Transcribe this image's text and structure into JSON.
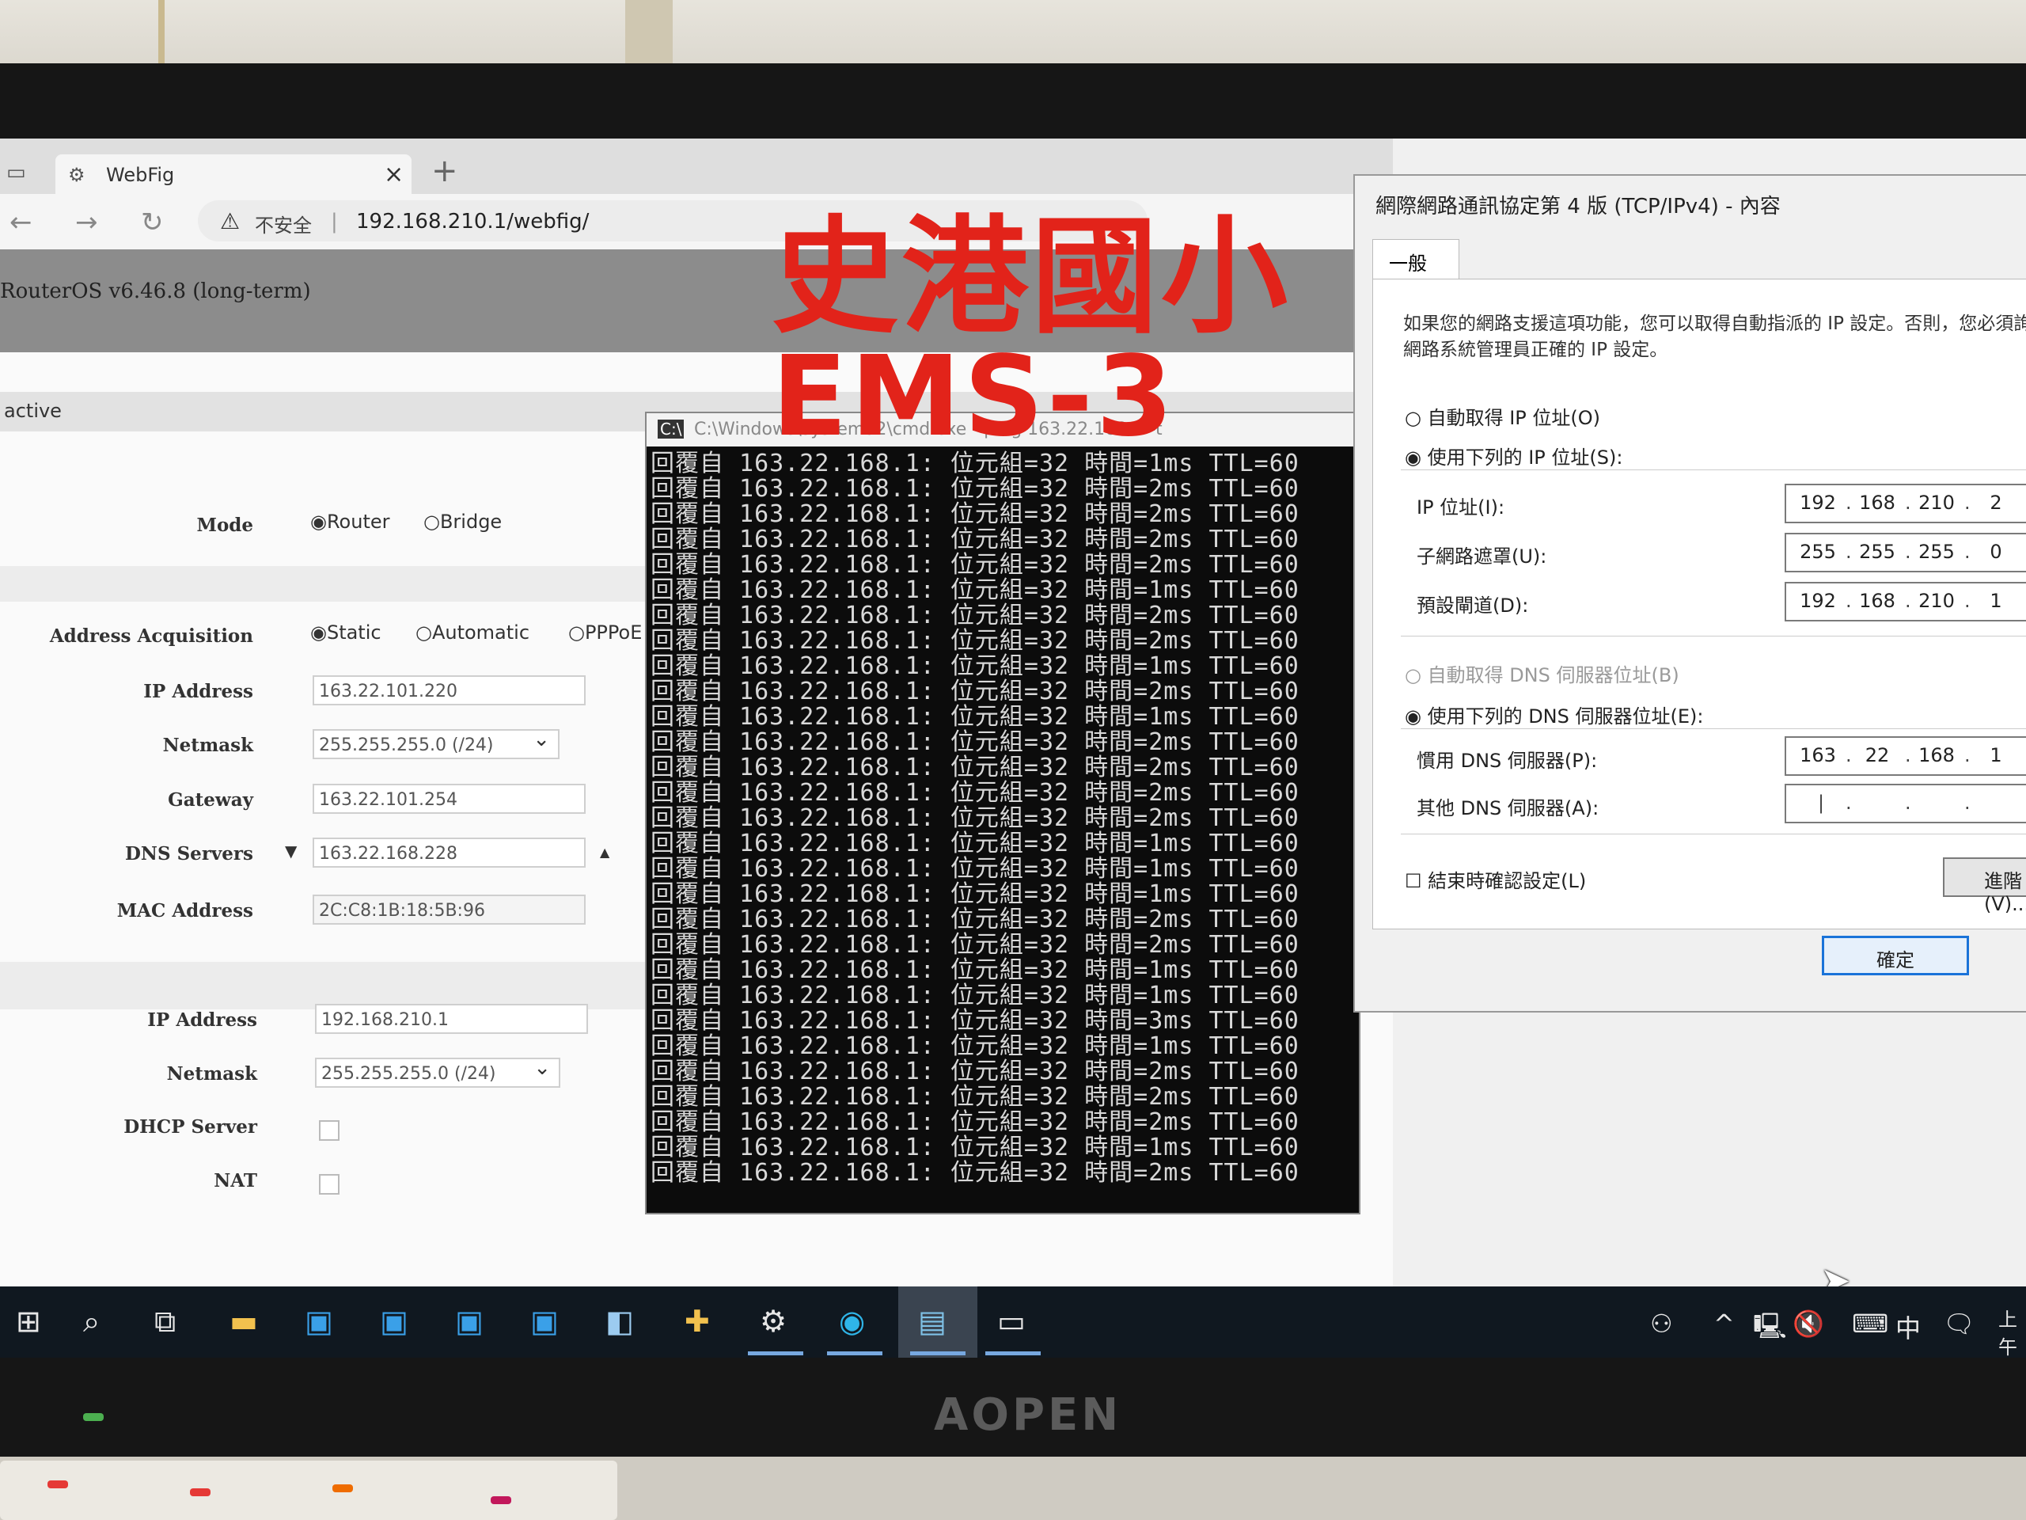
{
  "overlay": {
    "line1": "史港國小",
    "line2": "EMS-3"
  },
  "monitor": {
    "brand": "AOPEN"
  },
  "browser": {
    "tab_title": "WebFig",
    "tab_close": "×",
    "new_tab": "+",
    "insecure_label": "不安全",
    "url": "192.168.210.1/webfig/",
    "routeros_version": "RouterOS v6.46.8 (long-term)",
    "status": "active"
  },
  "form": {
    "mode_label": "Mode",
    "mode_options": [
      "Router",
      "Bridge"
    ],
    "mode_selected": "Router",
    "addr_acq_label": "Address Acquisition",
    "addr_acq_options": [
      "Static",
      "Automatic",
      "PPPoE"
    ],
    "addr_acq_selected": "Static",
    "wan": {
      "ip_label": "IP Address",
      "ip_value": "163.22.101.220",
      "netmask_label": "Netmask",
      "netmask_value": "255.255.255.0 (/24)",
      "gateway_label": "Gateway",
      "gateway_value": "163.22.101.254",
      "dns_label": "DNS Servers",
      "dns_value": "163.22.168.228",
      "mac_label": "MAC Address",
      "mac_value": "2C:C8:1B:18:5B:96"
    },
    "lan": {
      "ip_label": "IP Address",
      "ip_value": "192.168.210.1",
      "netmask_label": "Netmask",
      "netmask_value": "255.255.255.0 (/24)",
      "dhcp_label": "DHCP Server",
      "nat_label": "NAT"
    }
  },
  "cmd": {
    "title": "C:\\Windows\\system32\\cmd.exe - ping 163.22.168.1 -t",
    "prefix": "回覆自 163.22.168.1: 位元組=32 時間=",
    "suffix": " TTL=60",
    "times": [
      "1ms",
      "2ms",
      "2ms",
      "2ms",
      "2ms",
      "1ms",
      "2ms",
      "2ms",
      "1ms",
      "2ms",
      "1ms",
      "2ms",
      "2ms",
      "2ms",
      "2ms",
      "1ms",
      "1ms",
      "1ms",
      "2ms",
      "2ms",
      "1ms",
      "1ms",
      "3ms",
      "1ms",
      "2ms",
      "2ms",
      "2ms",
      "1ms",
      "2ms"
    ]
  },
  "dialog": {
    "title": "網際網路通訊協定第 4 版 (TCP/IPv4) - 內容",
    "tab": "一般",
    "description": "如果您的網路支援這項功能，您可以取得自動指派的 IP 設定。否則，您必須詢問網路系統管理員正確的 IP 設定。",
    "auto_ip": "自動取得 IP 位址(O)",
    "manual_ip": "使用下列的 IP 位址(S):",
    "ip_label": "IP 位址(I):",
    "ip": [
      "192",
      "168",
      "210",
      "2"
    ],
    "mask_label": "子網路遮罩(U):",
    "mask": [
      "255",
      "255",
      "255",
      "0"
    ],
    "gw_label": "預設閘道(D):",
    "gw": [
      "192",
      "168",
      "210",
      "1"
    ],
    "auto_dns": "自動取得 DNS 伺服器位址(B)",
    "manual_dns": "使用下列的 DNS 伺服器位址(E):",
    "pref_dns_label": "慣用 DNS 伺服器(P):",
    "pref_dns": [
      "163",
      "22",
      "168",
      "1"
    ],
    "alt_dns_label": "其他 DNS 伺服器(A):",
    "validate": "結束時確認設定(L)",
    "advanced": "進階(V)...",
    "ok": "確定"
  },
  "taskbar": {
    "ime": "中",
    "clock_partial": "上午"
  },
  "colors": {
    "overlay_red": "#e2231a",
    "cmd_bg": "#0c0c0c",
    "taskbar_bg": "#101820"
  }
}
